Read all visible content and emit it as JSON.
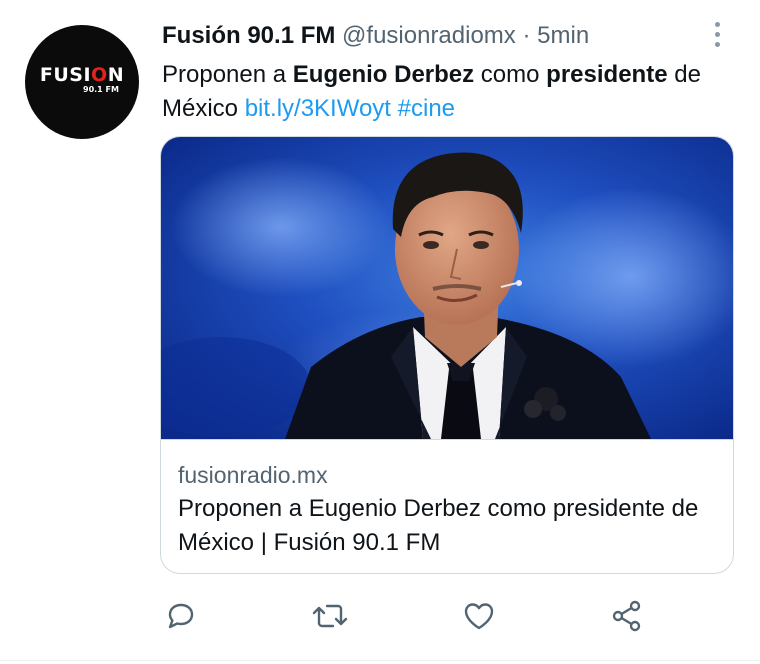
{
  "account": {
    "avatar_logo_left": "FUSI",
    "avatar_logo_o": "O",
    "avatar_logo_right": "N",
    "avatar_sub": "90.1 FM",
    "name": "Fusión 90.1 FM",
    "handle": "@fusionradiomx",
    "separator": "·",
    "time": "5min"
  },
  "tweet": {
    "t1": "Proponen a ",
    "t2": "Eugenio Derbez",
    "t3": " como ",
    "t4": "presidente",
    "t5": " de México ",
    "link": "bit.ly/3KIWoyt",
    "space": " ",
    "hashtag": "#cine"
  },
  "card": {
    "domain": "fusionradio.mx",
    "title": "Proponen a Eugenio Derbez como presidente de México | Fusión 90.1 FM"
  },
  "actions": {
    "icons": [
      "reply-icon",
      "retweet-icon",
      "like-icon",
      "share-icon"
    ]
  },
  "colors": {
    "accent": "#1d9bf0",
    "muted": "#536471",
    "icon": "#536471",
    "brand_red": "#e1231b"
  }
}
